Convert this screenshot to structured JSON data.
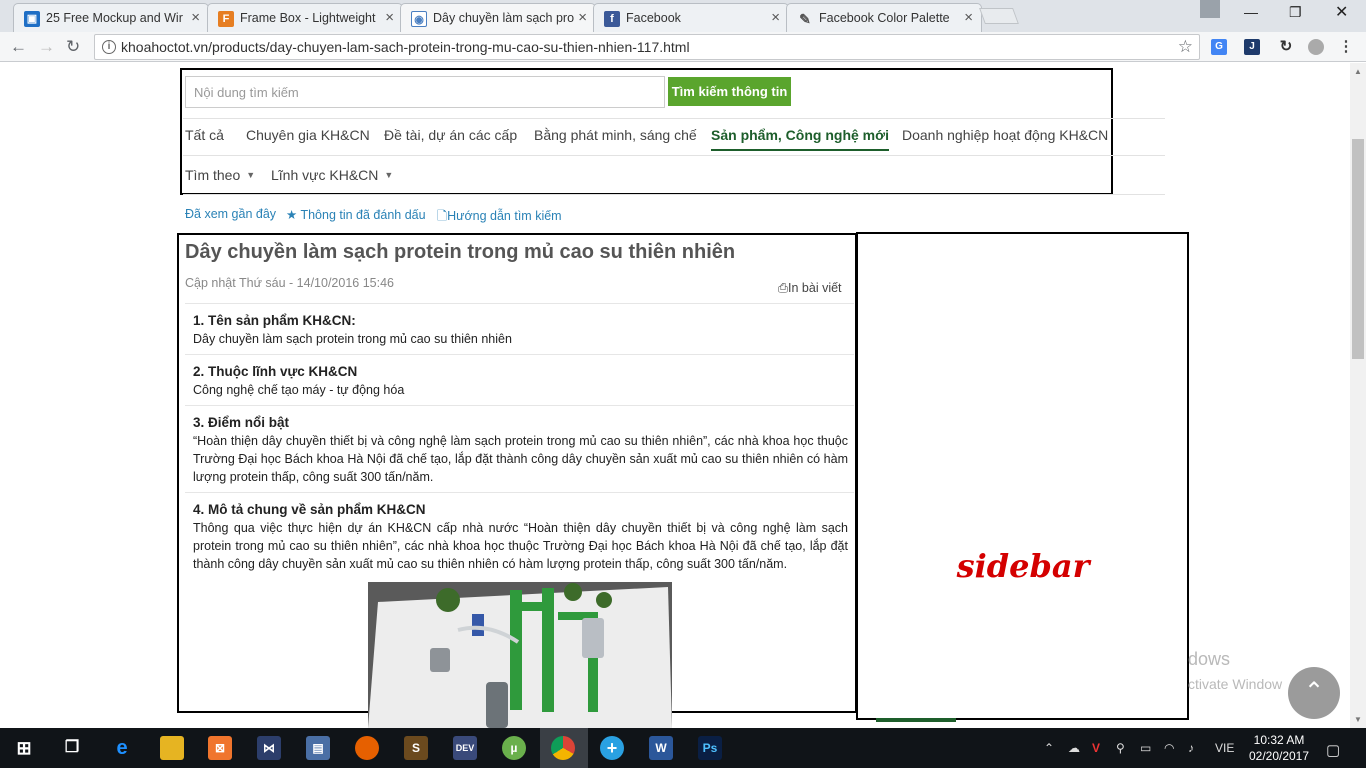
{
  "browser": {
    "tabs": [
      {
        "title": "25 Free Mockup and Wir",
        "favicon": "mockup-icon",
        "color": "#1f6fc5"
      },
      {
        "title": "Frame Box - Lightweight",
        "favicon": "framebox-icon",
        "color": "#e67e22"
      },
      {
        "title": "Dây chuyền làm sạch pro",
        "favicon": "khoahoc-icon",
        "color": "#4a7fc1"
      },
      {
        "title": "Facebook",
        "favicon": "facebook-icon",
        "color": "#3b5998"
      },
      {
        "title": "Facebook Color Palette",
        "favicon": "palette-icon",
        "color": "#555555"
      }
    ],
    "url": "khoahoctot.vn/products/day-chuyen-lam-sach-protein-trong-mu-cao-su-thien-nhien-117.html"
  },
  "search": {
    "placeholder": "Nội dung tìm kiếm",
    "button": "Tìm kiếm thông tin"
  },
  "categories": [
    {
      "label": "Tất cả",
      "active": false
    },
    {
      "label": "Chuyên gia KH&CN",
      "active": false
    },
    {
      "label": "Đề tài, dự án các cấp",
      "active": false
    },
    {
      "label": "Bằng phát minh, sáng chế",
      "active": false
    },
    {
      "label": "Sản phẩm, Công nghệ mới",
      "active": true
    },
    {
      "label": "Doanh nghiệp hoạt động KH&CN",
      "active": false
    }
  ],
  "filters": {
    "find_by": "Tìm theo",
    "field": "Lĩnh vực KH&CN"
  },
  "quick_links": {
    "recent": "Đã xem gần đây",
    "bookmarked": "Thông tin đã đánh dấu",
    "guide": "Hướng dẫn tìm kiếm"
  },
  "article": {
    "title": "Dây chuyền làm sạch protein trong mủ cao su thiên nhiên",
    "updated": "Cập nhật Thứ sáu - 14/10/2016 15:46",
    "print": "In bài viết",
    "sections": [
      {
        "heading": "1. Tên sản phẩm KH&CN:",
        "body": "Dây chuyền làm sạch protein trong mủ cao su thiên nhiên"
      },
      {
        "heading": "2. Thuộc lĩnh vực KH&CN",
        "body": "Công nghệ chế tạo máy - tự động hóa"
      },
      {
        "heading": "3. Điểm nổi bật",
        "body": "“Hoàn thiện dây chuyền thiết bị và công nghệ làm sạch protein trong mủ cao su thiên nhiên”, các nhà khoa học thuộc Trường Đại học Bách khoa Hà Nội đã chế tạo, lắp đặt thành công dây chuyền sản xuất mủ cao su thiên nhiên có hàm lượng protein thấp, công suất 300 tấn/năm."
      },
      {
        "heading": "4. Mô tả chung về sản phẩm KH&CN",
        "body": "Thông qua việc thực hiện dự án KH&CN cấp nhà nước “Hoàn thiện dây chuyền thiết bị và công nghệ làm sạch protein trong mủ cao su thiên nhiên”, các nhà khoa học thuộc Trường Đại học Bách khoa Hà Nội đã chế tạo, lắp đặt thành công dây chuyền sản xuất mủ cao su thiên nhiên có hàm lượng protein thấp, công suất 300 tấn/năm."
      }
    ]
  },
  "sidebar": {
    "label": "sidebar",
    "color": "#d40000"
  },
  "watermark": {
    "line1": "dows",
    "line2": "ctivate Window"
  },
  "taskbar": {
    "lang": "VIE",
    "time": "10:32 AM",
    "date": "02/20/2017"
  },
  "colors": {
    "accent_green": "#5aa52d",
    "active_category": "#1d5e2b",
    "link": "#2a82b6"
  }
}
